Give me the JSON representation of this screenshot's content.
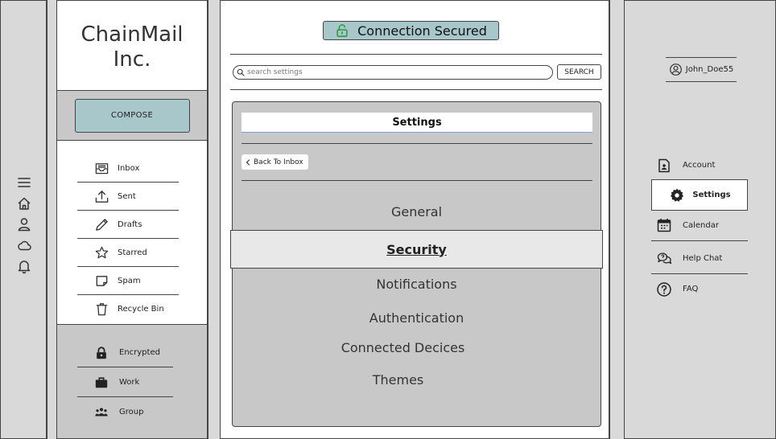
{
  "brand": {
    "line1": "ChainMail",
    "line2": "Inc."
  },
  "compose": {
    "label": "COMPOSE"
  },
  "mailbox": [
    {
      "label": "Inbox",
      "icon": "inbox-icon"
    },
    {
      "label": "Sent",
      "icon": "sent-icon"
    },
    {
      "label": "Drafts",
      "icon": "pencil-icon"
    },
    {
      "label": "Starred",
      "icon": "star-icon"
    },
    {
      "label": "Spam",
      "icon": "spam-icon"
    },
    {
      "label": "Recycle Bin",
      "icon": "trash-icon"
    }
  ],
  "labels": [
    {
      "label": "Encrypted",
      "icon": "lock-icon"
    },
    {
      "label": "Work",
      "icon": "briefcase-icon"
    },
    {
      "label": "Group",
      "icon": "group-icon"
    }
  ],
  "header": {
    "status": "Connection Secured"
  },
  "search": {
    "placeholder": "search settings",
    "button": "SEARCH"
  },
  "settings": {
    "title": "Settings",
    "back": "Back To Inbox",
    "items": [
      "General",
      "Security",
      "Notifications",
      "Authentication",
      "Connected Decices",
      "Themes"
    ],
    "active": "Security"
  },
  "user": {
    "name": "John_Doe55"
  },
  "right_nav": [
    {
      "label": "Account",
      "icon": "account-icon"
    },
    {
      "label": "Settings",
      "icon": "gear-icon"
    },
    {
      "label": "Calendar",
      "icon": "calendar-icon"
    },
    {
      "label": "Help Chat",
      "icon": "chat-icon"
    },
    {
      "label": "FAQ",
      "icon": "question-icon"
    }
  ],
  "colors": {
    "accent": "#a7c7cb",
    "panel": "#c8c8c8",
    "sidebar": "#d9d9d9"
  }
}
